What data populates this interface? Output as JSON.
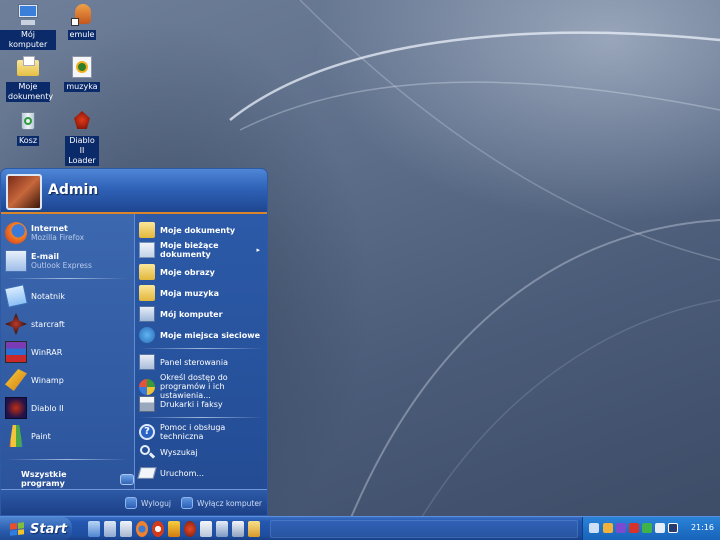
{
  "desktop": {
    "icons": [
      {
        "label": "Mój komputer",
        "icon": "computer-icon"
      },
      {
        "label": "emule",
        "icon": "emule-icon"
      },
      {
        "label": "Moje dokumenty",
        "icon": "folder-icon"
      },
      {
        "label": "muzyka",
        "icon": "music-icon"
      },
      {
        "label": "Kosz",
        "icon": "recycle-bin-icon"
      },
      {
        "label": "Diablo II Loader",
        "icon": "diablo-icon"
      }
    ]
  },
  "start_menu": {
    "user_name": "Admin",
    "pinned": [
      {
        "title": "Internet",
        "subtitle": "Mozilla Firefox",
        "icon": "firefox-icon"
      },
      {
        "title": "E-mail",
        "subtitle": "Outlook Express",
        "icon": "outlook-icon"
      }
    ],
    "recent": [
      {
        "label": "Notatnik",
        "icon": "notepad-icon"
      },
      {
        "label": "starcraft",
        "icon": "starcraft-icon"
      },
      {
        "label": "WinRAR",
        "icon": "winrar-icon"
      },
      {
        "label": "Winamp",
        "icon": "winamp-icon"
      },
      {
        "label": "Diablo II",
        "icon": "diablo-icon"
      },
      {
        "label": "Paint",
        "icon": "paint-icon"
      }
    ],
    "all_programs": "Wszystkie programy",
    "places": [
      {
        "label": "Moje dokumenty",
        "icon": "folder-icon"
      },
      {
        "label": "Moje bieżące dokumenty",
        "icon": "recent-docs-icon"
      },
      {
        "label": "Moje obrazy",
        "icon": "pictures-icon"
      },
      {
        "label": "Moja muzyka",
        "icon": "music-folder-icon"
      },
      {
        "label": "Mój komputer",
        "icon": "computer-icon"
      },
      {
        "label": "Moje miejsca sieciowe",
        "icon": "network-icon"
      }
    ],
    "system": [
      {
        "label": "Panel sterowania",
        "icon": "control-panel-icon"
      },
      {
        "label": "Określ dostęp do programów i ich ustawienia...",
        "icon": "program-access-icon"
      },
      {
        "label": "Drukarki i faksy",
        "icon": "printer-icon"
      }
    ],
    "tools": [
      {
        "label": "Pomoc i obsługa techniczna",
        "icon": "help-icon"
      },
      {
        "label": "Wyszukaj",
        "icon": "search-icon"
      },
      {
        "label": "Uruchom...",
        "icon": "run-icon"
      }
    ],
    "logoff": "Wyloguj",
    "shutdown": "Wyłącz komputer"
  },
  "taskbar": {
    "start_label": "Start",
    "clock": "21:16"
  }
}
